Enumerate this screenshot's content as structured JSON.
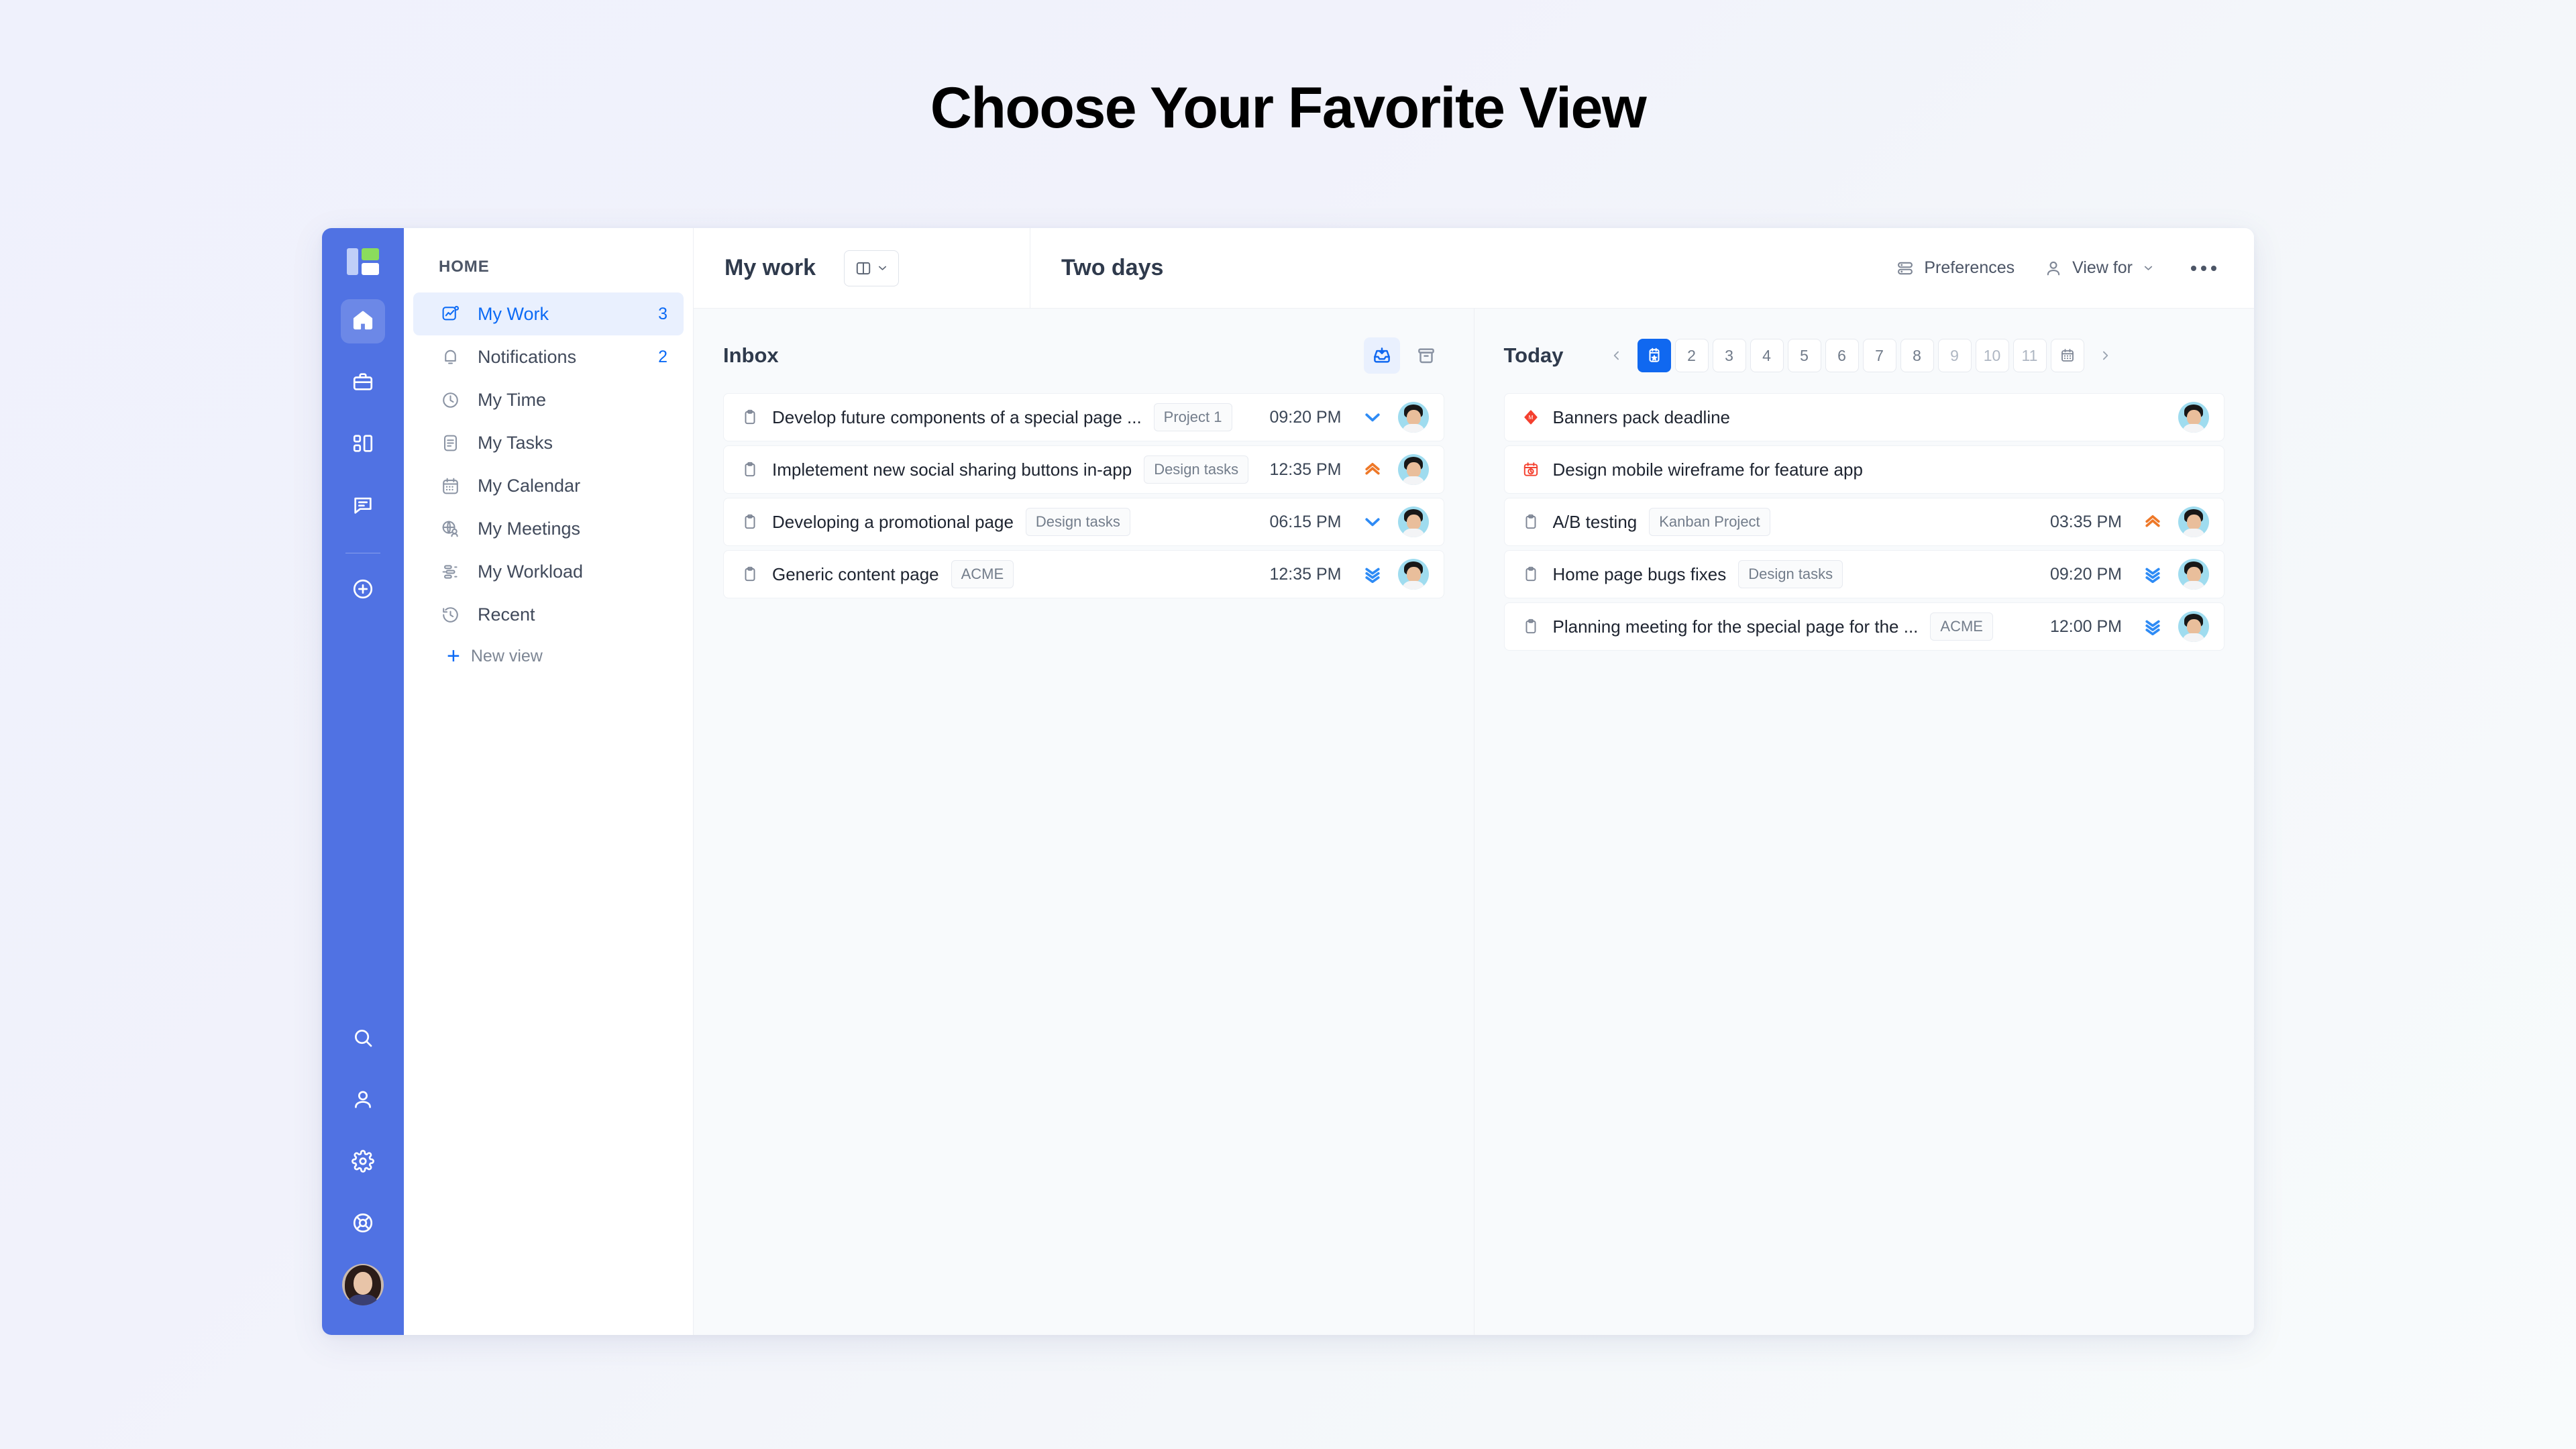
{
  "page": {
    "title": "Choose Your Favorite View"
  },
  "icon_rail": {
    "logo_name": "app-logo",
    "buttons": [
      {
        "name": "home-icon",
        "label": "Home",
        "active": true
      },
      {
        "name": "briefcase-icon",
        "label": "Portfolio",
        "active": false
      },
      {
        "name": "dashboard-icon",
        "label": "Dashboards",
        "active": false
      },
      {
        "name": "chat-icon",
        "label": "Chat",
        "active": false
      },
      {
        "name": "plus-circle-icon",
        "label": "Create",
        "active": false
      }
    ],
    "bottom_buttons": [
      {
        "name": "search-icon",
        "label": "Search"
      },
      {
        "name": "person-icon",
        "label": "People"
      },
      {
        "name": "gear-icon",
        "label": "Settings"
      },
      {
        "name": "lifebuoy-icon",
        "label": "Help"
      }
    ],
    "avatar_label": "User avatar"
  },
  "sidebar": {
    "section_label": "HOME",
    "items": [
      {
        "label": "My Work",
        "count": "3",
        "icon": "chart-check-icon",
        "active": true
      },
      {
        "label": "Notifications",
        "count": "2",
        "icon": "bell-icon",
        "active": false
      },
      {
        "label": "My Time",
        "count": "",
        "icon": "clock-icon",
        "active": false
      },
      {
        "label": "My Tasks",
        "count": "",
        "icon": "document-icon",
        "active": false
      },
      {
        "label": "My Calendar",
        "count": "",
        "icon": "calendar-icon",
        "active": false
      },
      {
        "label": "My Meetings",
        "count": "",
        "icon": "globe-person-icon",
        "active": false
      },
      {
        "label": "My Workload",
        "count": "",
        "icon": "workload-icon",
        "active": false
      },
      {
        "label": "Recent",
        "count": "",
        "icon": "history-icon",
        "active": false
      }
    ],
    "new_view_label": "New view",
    "new_view_plus": "+"
  },
  "header": {
    "title": "My work",
    "layout_button_name": "layout-columns-dropdown",
    "section_title": "Two days",
    "preferences_label": "Preferences",
    "view_for_label": "View for",
    "more_label": "More options"
  },
  "inbox": {
    "title": "Inbox",
    "actions": [
      {
        "name": "inbox-icon",
        "selected": true
      },
      {
        "name": "archive-icon",
        "selected": false
      }
    ],
    "tasks": [
      {
        "title": "Develop future components of a special page ...",
        "tag": "Project 1",
        "time": "09:20 PM",
        "priority": "low",
        "icon": "task-icon"
      },
      {
        "title": "Impletement new social sharing buttons in-app",
        "tag": "Design tasks",
        "time": "12:35 PM",
        "priority": "high",
        "icon": "task-icon"
      },
      {
        "title": "Developing a promotional page",
        "tag": "Design tasks",
        "time": "06:15 PM",
        "priority": "low",
        "icon": "task-icon"
      },
      {
        "title": "Generic content page",
        "tag": "ACME",
        "time": "12:35 PM",
        "priority": "lowest",
        "icon": "task-icon"
      }
    ]
  },
  "today": {
    "title": "Today",
    "date_strip": {
      "prev_name": "prev-day-arrow",
      "next_name": "next-day-arrow",
      "today_name": "today-calendar-icon",
      "calendar_name": "calendar-picker-icon",
      "days": [
        "2",
        "3",
        "4",
        "5",
        "6",
        "7",
        "8",
        "9",
        "10",
        "11"
      ],
      "dim_from": 8
    },
    "tasks": [
      {
        "title": "Banners pack deadline",
        "tag": "",
        "time": "",
        "priority": "",
        "icon": "milestone-icon"
      },
      {
        "title": "Design mobile wireframe for  feature app",
        "tag": "",
        "time": "",
        "priority": "",
        "icon": "deadline-icon"
      },
      {
        "title": "A/B testing",
        "tag": "Kanban Project",
        "time": "03:35 PM",
        "priority": "high",
        "icon": "task-icon"
      },
      {
        "title": "Home page bugs fixes",
        "tag": "Design tasks",
        "time": "09:20 PM",
        "priority": "lowest",
        "icon": "task-icon"
      },
      {
        "title": "Planning meeting for the special page for the ...",
        "tag": "ACME",
        "time": "12:00 PM",
        "priority": "lowest",
        "icon": "task-icon"
      }
    ]
  },
  "colors": {
    "rail_blue": "#5072E3",
    "accent_blue": "#1068F0",
    "link_blue": "#0B6AF5",
    "priority_high": "#EE7828",
    "priority_low": "#2E8BF5",
    "danger_red": "#F4402F",
    "logo_green": "#8BDC5C"
  }
}
